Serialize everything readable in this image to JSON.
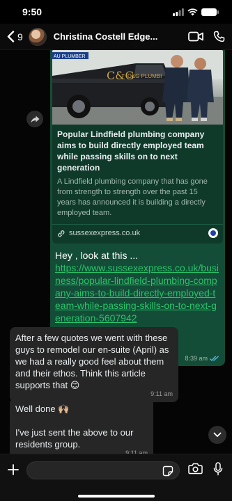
{
  "status_bar": {
    "time": "9:50"
  },
  "header": {
    "back_count": "9",
    "contact_name": "Christina Costell Edge..."
  },
  "outgoing_message": {
    "preview": {
      "title": "Popular Lindfield plumbing company aims to build directly employed team while passing skills on to next generation",
      "description": "A Lindfield plumbing company that has gone from strength to strength over the past 15 years has announced it is building a directly employed team.",
      "domain": "sussexexpress.co.uk",
      "image_sign_text": "C&G PLUMBI",
      "image_plate_text": "AU PLUMBER"
    },
    "lead_text": "Hey , look at this ...",
    "link": "https://www.sussexexpress.co.uk/business/popular-lindfield-plumbing-company-aims-to-build-directly-employed-team-while-passing-skills-on-to-next-generation-5607942",
    "time": "8:39 am"
  },
  "incoming_messages": [
    {
      "text": "After a few quotes we went with these guys to remodel our en-suite (April) as we had a really good feel about them and their ethos. Think this article supports that 😊",
      "time": "9:11 am"
    },
    {
      "text": "Well done 🙌🏼\n\nI've just sent the above to our residents group.",
      "time": "9:11 am"
    }
  ],
  "input": {
    "placeholder": ""
  },
  "colors": {
    "outgoing_bubble": "#144d37",
    "incoming_bubble": "#262626",
    "link": "#29c36b",
    "background": "#050505"
  },
  "icons": [
    "back-chevron-icon",
    "video-call-icon",
    "phone-icon",
    "share-icon",
    "read-receipt-icon",
    "plus-icon",
    "sticker-icon",
    "camera-icon",
    "mic-icon",
    "chevron-down-icon"
  ]
}
